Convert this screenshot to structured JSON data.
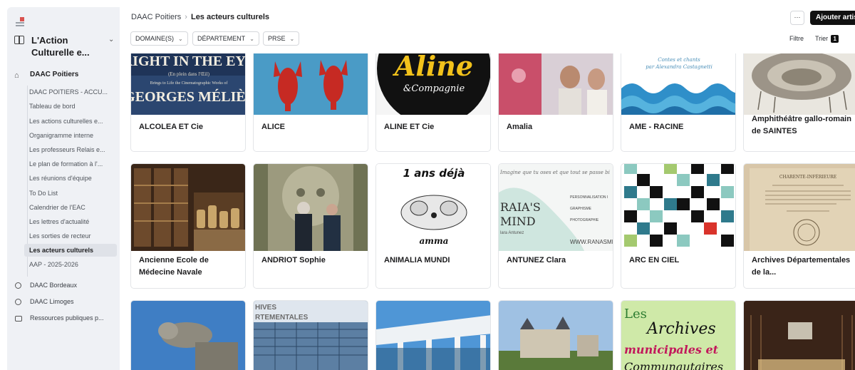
{
  "sidebar": {
    "workspace_title": "L'Action Culturelle e...",
    "top_item": "DAAC Poitiers",
    "sub_items": [
      "DAAC POITIERS - ACCU...",
      "Tableau de bord",
      "Les actions culturelles e...",
      "Organigramme interne",
      "Les professeurs Relais e...",
      "Le plan de formation à l'...",
      "Les réunions d'équipe",
      "To Do List",
      "Calendrier de l'EAC",
      "Les lettres d'actualité",
      "Les sorties de recteur",
      "Les acteurs culturels",
      "AAP - 2025-2026"
    ],
    "active_sub": "Les acteurs culturels",
    "bottom_items": [
      "DAAC Bordeaux",
      "DAAC Limoges",
      "Ressources publiques p..."
    ]
  },
  "header": {
    "breadcrumb_parent": "DAAC Poitiers",
    "breadcrumb_current": "Les acteurs culturels",
    "more_label": "···",
    "add_label": "Ajouter artist",
    "filters": [
      "DOMAINE(S)",
      "DÉPARTEMENT",
      "PRSE"
    ],
    "filtre_label": "Filtre",
    "trier_label": "Trier",
    "trier_count": "1"
  },
  "cards": [
    {
      "name": "ALCOLEA ET Cie",
      "thumb": "poster-melies",
      "thumb_text": [
        "RIGHT IN THE EYE",
        "(En plein dans l'Œil)",
        "Brings to Life the Cinematographic Works of",
        "GEORGES MÉLIÈS"
      ]
    },
    {
      "name": "ALICE",
      "thumb": "lobsters"
    },
    {
      "name": "ALINE ET Cie",
      "thumb": "aline-logo",
      "thumb_text": [
        "Aline",
        "&Compagnie"
      ]
    },
    {
      "name": "Amalia",
      "thumb": "amalia-photo"
    },
    {
      "name": "AME - RACINE",
      "thumb": "waves",
      "thumb_text": [
        "Contes et chants",
        "par Alexandra Castagnetti"
      ]
    },
    {
      "name": "Amphithéâtre gallo-romain de SAINTES",
      "thumb": "amphitheatre"
    },
    {
      "name": "Ancienne Ecole de Médecine Navale",
      "thumb": "library"
    },
    {
      "name": "ANDRIOT Sophie",
      "thumb": "statue-readers"
    },
    {
      "name": "ANIMALIA MUNDI",
      "thumb": "dog-drawing",
      "thumb_text": [
        "1 ans déjà",
        "amma"
      ]
    },
    {
      "name": "ANTUNEZ Clara",
      "thumb": "clara-card",
      "thumb_text": [
        "Imagine que tu oses et que tout se passe bi",
        "PERSONNALISATION I",
        "GRAPHISME",
        "PHOTOGRAPHIE",
        "WWW.RANASMIN",
        "lara Antunez"
      ]
    },
    {
      "name": "ARC EN CIEL",
      "thumb": "mosaic"
    },
    {
      "name": "Archives Départementales de la...",
      "thumb": "old-document",
      "thumb_text": [
        "CHARENTE-INFÉRIEURE"
      ]
    },
    {
      "name": "",
      "thumb": "gargoyle"
    },
    {
      "name": "",
      "thumb": "archives-building",
      "thumb_text": [
        "HIVES",
        "RTEMENTALES"
      ]
    },
    {
      "name": "",
      "thumb": "modern-building"
    },
    {
      "name": "",
      "thumb": "castle"
    },
    {
      "name": "",
      "thumb": "archives-municipales",
      "thumb_text": [
        "Les",
        "Archives",
        "municipales et",
        "Communautaires"
      ]
    },
    {
      "name": "",
      "thumb": "concert-hall"
    }
  ]
}
